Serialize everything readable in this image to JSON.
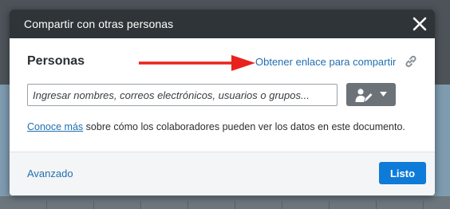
{
  "dialog": {
    "title": "Compartir con otras personas",
    "close_icon": "close-icon"
  },
  "people": {
    "heading": "Personas",
    "get_link_label": "Obtener enlace para compartir",
    "link_icon": "link-icon",
    "input_placeholder": "Ingresar nombres, correos electrónicos, usuarios o grupos...",
    "input_value": "",
    "permission_icon": "edit-permission-icon"
  },
  "help": {
    "link_label": "Conoce más",
    "text": " sobre cómo los colaboradores pueden ver los datos en este documento."
  },
  "footer": {
    "advanced_label": "Avanzado",
    "done_label": "Listo"
  },
  "colors": {
    "header_bg": "#2f3438",
    "link": "#1f6fb2",
    "primary_button": "#0f7bd8",
    "annotation_arrow": "#e8231c"
  }
}
